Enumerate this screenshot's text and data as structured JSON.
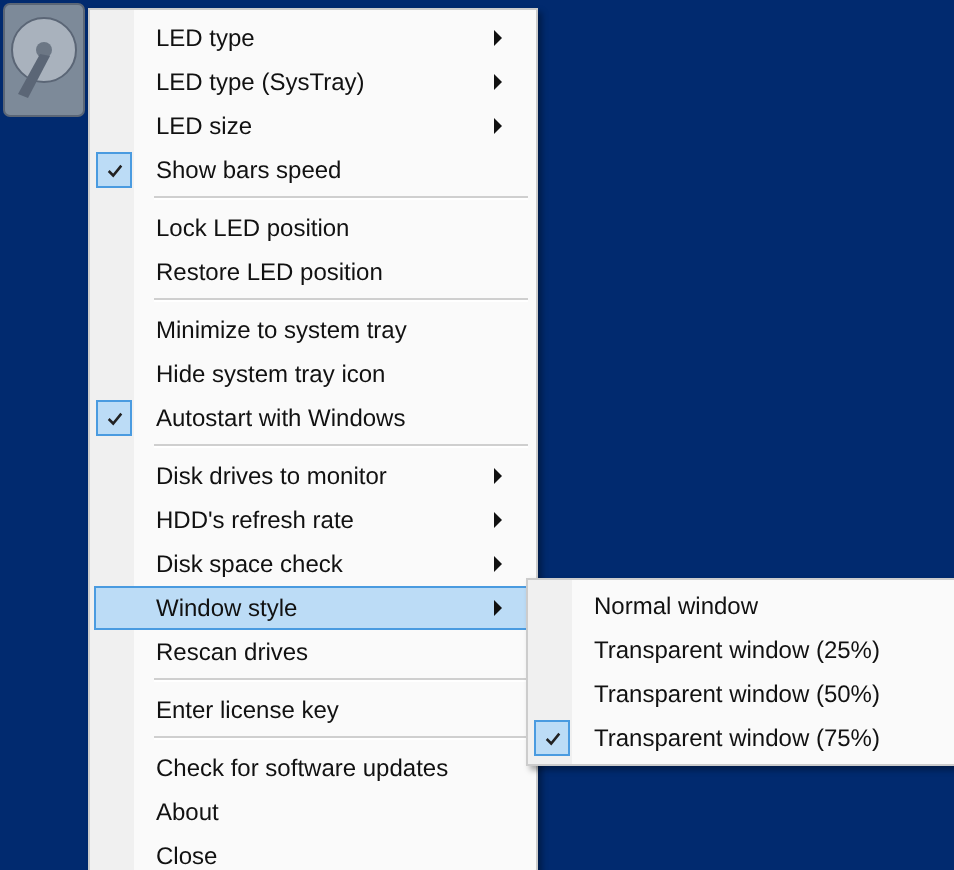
{
  "menu": [
    {
      "kind": "item",
      "label": "LED type",
      "checked": false,
      "submenu_arrow": true,
      "selected": false
    },
    {
      "kind": "item",
      "label": "LED type (SysTray)",
      "checked": false,
      "submenu_arrow": true,
      "selected": false
    },
    {
      "kind": "item",
      "label": "LED size",
      "checked": false,
      "submenu_arrow": true,
      "selected": false
    },
    {
      "kind": "item",
      "label": "Show bars speed",
      "checked": true,
      "submenu_arrow": false,
      "selected": false
    },
    {
      "kind": "separator"
    },
    {
      "kind": "item",
      "label": "Lock LED position",
      "checked": false,
      "submenu_arrow": false,
      "selected": false
    },
    {
      "kind": "item",
      "label": "Restore LED position",
      "checked": false,
      "submenu_arrow": false,
      "selected": false
    },
    {
      "kind": "separator"
    },
    {
      "kind": "item",
      "label": "Minimize to system tray",
      "checked": false,
      "submenu_arrow": false,
      "selected": false
    },
    {
      "kind": "item",
      "label": "Hide system tray icon",
      "checked": false,
      "submenu_arrow": false,
      "selected": false
    },
    {
      "kind": "item",
      "label": "Autostart with Windows",
      "checked": true,
      "submenu_arrow": false,
      "selected": false
    },
    {
      "kind": "separator"
    },
    {
      "kind": "item",
      "label": "Disk drives to monitor",
      "checked": false,
      "submenu_arrow": true,
      "selected": false
    },
    {
      "kind": "item",
      "label": "HDD's refresh rate",
      "checked": false,
      "submenu_arrow": true,
      "selected": false
    },
    {
      "kind": "item",
      "label": "Disk space check",
      "checked": false,
      "submenu_arrow": true,
      "selected": false
    },
    {
      "kind": "item",
      "label": "Window style",
      "checked": false,
      "submenu_arrow": true,
      "selected": true
    },
    {
      "kind": "item",
      "label": "Rescan drives",
      "checked": false,
      "submenu_arrow": false,
      "selected": false
    },
    {
      "kind": "separator"
    },
    {
      "kind": "item",
      "label": "Enter license key",
      "checked": false,
      "submenu_arrow": false,
      "selected": false
    },
    {
      "kind": "separator"
    },
    {
      "kind": "item",
      "label": "Check for software updates",
      "checked": false,
      "submenu_arrow": false,
      "selected": false
    },
    {
      "kind": "item",
      "label": "About",
      "checked": false,
      "submenu_arrow": false,
      "selected": false
    },
    {
      "kind": "item",
      "label": "Close",
      "checked": false,
      "submenu_arrow": false,
      "selected": false
    }
  ],
  "submenu": [
    {
      "label": "Normal window",
      "checked": false
    },
    {
      "label": "Transparent window (25%)",
      "checked": false
    },
    {
      "label": "Transparent window (50%)",
      "checked": false
    },
    {
      "label": "Transparent window (75%)",
      "checked": true
    }
  ]
}
